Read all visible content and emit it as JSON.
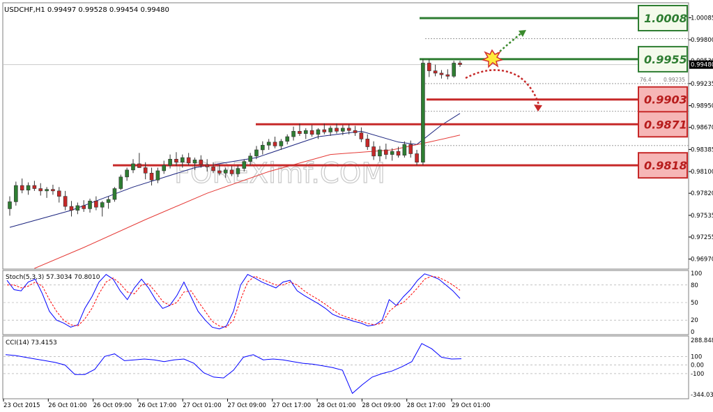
{
  "chart_data": [
    {
      "type": "candlestick",
      "symbol_header": "USDCHF,H1  0.99497 0.99528 0.99454 0.99480",
      "current_price": "0.99480",
      "ylim": [
        0.9685,
        1.0026
      ],
      "y_tick_labels": [
        "1.00085",
        "0.99800",
        "0.99530",
        "0.99235",
        "0.98950",
        "0.98670",
        "0.98385",
        "0.98100",
        "0.97820",
        "0.97535",
        "0.97255",
        "0.96970"
      ],
      "y_tick_values": [
        1.00085,
        0.998,
        0.9953,
        0.99235,
        0.9895,
        0.9867,
        0.98385,
        0.981,
        0.9782,
        0.97535,
        0.97255,
        0.9697
      ],
      "x_tick_labels": [
        "23 Oct 2015",
        "26 Oct 01:00",
        "26 Oct 09:00",
        "26 Oct 17:00",
        "27 Oct 01:00",
        "27 Oct 09:00",
        "27 Oct 17:00",
        "28 Oct 01:00",
        "28 Oct 09:00",
        "28 Oct 17:00",
        "29 Oct 01:00"
      ],
      "candles": [
        [
          0.9762,
          0.9778,
          0.9753,
          0.9771
        ],
        [
          0.9771,
          0.9797,
          0.9766,
          0.9792
        ],
        [
          0.9792,
          0.9801,
          0.9782,
          0.9786
        ],
        [
          0.9786,
          0.9796,
          0.978,
          0.9792
        ],
        [
          0.9792,
          0.9798,
          0.9785,
          0.9788
        ],
        [
          0.9788,
          0.9795,
          0.9779,
          0.9785
        ],
        [
          0.9785,
          0.979,
          0.9776,
          0.9787
        ],
        [
          0.9787,
          0.9793,
          0.978,
          0.9785
        ],
        [
          0.9785,
          0.979,
          0.977,
          0.9778
        ],
        [
          0.9778,
          0.9785,
          0.976,
          0.9765
        ],
        [
          0.9765,
          0.9772,
          0.9752,
          0.976
        ],
        [
          0.976,
          0.977,
          0.9755,
          0.9766
        ],
        [
          0.9766,
          0.9773,
          0.9758,
          0.9762
        ],
        [
          0.9762,
          0.9775,
          0.9757,
          0.9772
        ],
        [
          0.9772,
          0.9778,
          0.976,
          0.9764
        ],
        [
          0.9764,
          0.9772,
          0.9752,
          0.977
        ],
        [
          0.977,
          0.9778,
          0.9762,
          0.9774
        ],
        [
          0.9774,
          0.979,
          0.9771,
          0.9788
        ],
        [
          0.9788,
          0.9806,
          0.9786,
          0.9803
        ],
        [
          0.9803,
          0.9815,
          0.9798,
          0.9812
        ],
        [
          0.9812,
          0.9826,
          0.9808,
          0.982
        ],
        [
          0.982,
          0.9834,
          0.9815,
          0.9815
        ],
        [
          0.9815,
          0.9822,
          0.98,
          0.9808
        ],
        [
          0.9808,
          0.9815,
          0.9792,
          0.9799
        ],
        [
          0.9799,
          0.9815,
          0.9795,
          0.9811
        ],
        [
          0.9811,
          0.9824,
          0.9807,
          0.9818
        ],
        [
          0.9818,
          0.9832,
          0.9814,
          0.9826
        ],
        [
          0.9826,
          0.9835,
          0.9817,
          0.9822
        ],
        [
          0.9822,
          0.9832,
          0.9815,
          0.9828
        ],
        [
          0.9828,
          0.9834,
          0.9818,
          0.9821
        ],
        [
          0.9821,
          0.9828,
          0.9812,
          0.9825
        ],
        [
          0.9825,
          0.9831,
          0.9815,
          0.9819
        ],
        [
          0.9819,
          0.9826,
          0.981,
          0.9816
        ],
        [
          0.9816,
          0.9822,
          0.9808,
          0.9811
        ],
        [
          0.9811,
          0.9819,
          0.9805,
          0.9808
        ],
        [
          0.9808,
          0.9815,
          0.9802,
          0.9812
        ],
        [
          0.9812,
          0.9817,
          0.9804,
          0.9807
        ],
        [
          0.9807,
          0.9818,
          0.9803,
          0.9814
        ],
        [
          0.9814,
          0.9826,
          0.981,
          0.9823
        ],
        [
          0.9823,
          0.9834,
          0.9818,
          0.983
        ],
        [
          0.983,
          0.9843,
          0.9826,
          0.9838
        ],
        [
          0.9838,
          0.9849,
          0.9832,
          0.9844
        ],
        [
          0.9844,
          0.9852,
          0.9838,
          0.9848
        ],
        [
          0.9848,
          0.9855,
          0.984,
          0.9843
        ],
        [
          0.9843,
          0.9852,
          0.9838,
          0.9849
        ],
        [
          0.9849,
          0.9858,
          0.9845,
          0.9855
        ],
        [
          0.9855,
          0.9868,
          0.985,
          0.9862
        ],
        [
          0.9862,
          0.9872,
          0.9856,
          0.9859
        ],
        [
          0.9859,
          0.9866,
          0.9852,
          0.9863
        ],
        [
          0.9863,
          0.987,
          0.9855,
          0.9858
        ],
        [
          0.9858,
          0.9866,
          0.9852,
          0.9864
        ],
        [
          0.9864,
          0.9872,
          0.9858,
          0.9861
        ],
        [
          0.9861,
          0.9869,
          0.9856,
          0.9866
        ],
        [
          0.9866,
          0.9872,
          0.9859,
          0.9862
        ],
        [
          0.9862,
          0.987,
          0.9857,
          0.9866
        ],
        [
          0.9866,
          0.9871,
          0.9858,
          0.9863
        ],
        [
          0.9863,
          0.9869,
          0.9856,
          0.986
        ],
        [
          0.986,
          0.9867,
          0.9848,
          0.9852
        ],
        [
          0.9852,
          0.9858,
          0.9838,
          0.9842
        ],
        [
          0.9842,
          0.9849,
          0.9825,
          0.983
        ],
        [
          0.983,
          0.9843,
          0.9823,
          0.9838
        ],
        [
          0.9838,
          0.9846,
          0.9826,
          0.9832
        ],
        [
          0.9832,
          0.984,
          0.9824,
          0.9836
        ],
        [
          0.9836,
          0.9842,
          0.9828,
          0.9831
        ],
        [
          0.9831,
          0.9849,
          0.9828,
          0.9845
        ],
        [
          0.9845,
          0.985,
          0.9828,
          0.9833
        ],
        [
          0.9833,
          0.9838,
          0.9818,
          0.9822
        ],
        [
          0.9822,
          0.9955,
          0.9818,
          0.995
        ],
        [
          0.995,
          0.9955,
          0.9932,
          0.994
        ],
        [
          0.994,
          0.9948,
          0.9933,
          0.9937
        ],
        [
          0.9937,
          0.9941,
          0.993,
          0.9935
        ],
        [
          0.9935,
          0.9942,
          0.9929,
          0.9933
        ],
        [
          0.9933,
          0.9953,
          0.9931,
          0.995
        ],
        [
          0.995,
          0.9953,
          0.9945,
          0.9948
        ]
      ],
      "ma_blue": [
        [
          0,
          0.9738
        ],
        [
          10,
          0.976
        ],
        [
          20,
          0.979
        ],
        [
          30,
          0.9815
        ],
        [
          40,
          0.9828
        ],
        [
          50,
          0.9855
        ],
        [
          57,
          0.9862
        ],
        [
          63,
          0.9848
        ],
        [
          66,
          0.9845
        ],
        [
          70,
          0.987
        ],
        [
          73,
          0.9885
        ]
      ],
      "ma_red": [
        [
          4,
          0.9685
        ],
        [
          12,
          0.9712
        ],
        [
          22,
          0.9748
        ],
        [
          32,
          0.9782
        ],
        [
          42,
          0.981
        ],
        [
          52,
          0.9832
        ],
        [
          62,
          0.9838
        ],
        [
          68,
          0.9848
        ],
        [
          73,
          0.9857
        ]
      ],
      "fib_ratio_label": "76.4",
      "fib_price_label": "0.99235",
      "levels": [
        {
          "label": "1.0008",
          "value": 1.0008,
          "color": "#2e7d32",
          "kind": "resistance"
        },
        {
          "label": "0.9955",
          "value": 0.9955,
          "color": "#2e7d32",
          "kind": "resistance"
        },
        {
          "label": "0.9903",
          "value": 0.9903,
          "color": "#c62828",
          "kind": "support"
        },
        {
          "label": "0.9871",
          "value": 0.9871,
          "color": "#c62828",
          "kind": "support"
        },
        {
          "label": "0.9818",
          "value": 0.9818,
          "color": "#c62828",
          "kind": "support"
        }
      ],
      "watermark": "FOREXimf.COM"
    },
    {
      "type": "line",
      "title": "Stoch(5,3,3) 57.3034 70.8010",
      "ylim": [
        0,
        100
      ],
      "y_tick_labels": [
        "100",
        "80",
        "50",
        "20",
        "0"
      ],
      "y_tick_values": [
        100,
        80,
        50,
        20,
        0
      ],
      "series": [
        {
          "color": "#0000ff",
          "values": [
            88,
            72,
            70,
            85,
            90,
            65,
            35,
            20,
            15,
            8,
            12,
            40,
            60,
            85,
            98,
            90,
            70,
            55,
            75,
            90,
            75,
            55,
            40,
            45,
            62,
            85,
            60,
            35,
            20,
            8,
            5,
            10,
            35,
            80,
            98,
            92,
            85,
            80,
            75,
            85,
            88,
            70,
            62,
            55,
            48,
            40,
            30,
            25,
            22,
            18,
            15,
            10,
            12,
            20,
            55,
            45,
            60,
            72,
            88,
            99,
            95,
            90,
            80,
            70,
            57
          ]
        },
        {
          "color": "#ff0000",
          "values": [
            80,
            80,
            75,
            78,
            85,
            78,
            55,
            35,
            20,
            12,
            10,
            22,
            40,
            65,
            85,
            92,
            82,
            68,
            65,
            80,
            82,
            68,
            52,
            45,
            50,
            68,
            70,
            52,
            35,
            18,
            10,
            8,
            20,
            55,
            85,
            95,
            90,
            85,
            80,
            80,
            85,
            80,
            70,
            62,
            55,
            47,
            38,
            30,
            25,
            22,
            18,
            14,
            12,
            15,
            35,
            45,
            50,
            62,
            75,
            90,
            95,
            93,
            87,
            80,
            71
          ]
        }
      ]
    },
    {
      "type": "line",
      "title": "CCI(14) 73.4153",
      "ylim": [
        -344.0368,
        288.8484
      ],
      "y_tick_labels": [
        "288.848",
        "100",
        "0.00",
        "-100",
        "-344.036"
      ],
      "y_tick_values": [
        288.848,
        100,
        0,
        -100,
        -344.036
      ],
      "series": [
        {
          "color": "#0000ff",
          "values": [
            120,
            110,
            90,
            70,
            50,
            30,
            0,
            -110,
            -110,
            -50,
            100,
            130,
            50,
            60,
            70,
            60,
            40,
            60,
            70,
            20,
            -90,
            -140,
            -150,
            -60,
            90,
            120,
            60,
            70,
            60,
            40,
            20,
            10,
            -10,
            -30,
            -60,
            -330,
            -230,
            -140,
            -100,
            -70,
            -20,
            40,
            250,
            190,
            90,
            70,
            73
          ]
        }
      ]
    }
  ],
  "x_axis": {
    "labels": [
      "23 Oct 2015",
      "26 Oct 01:00",
      "26 Oct 09:00",
      "26 Oct 17:00",
      "27 Oct 01:00",
      "27 Oct 09:00",
      "27 Oct 17:00",
      "28 Oct 01:00",
      "28 Oct 09:00",
      "28 Oct 17:00",
      "29 Oct 01:00"
    ]
  },
  "colors": {
    "bull_fill": "#2e7d32",
    "bear_fill": "#c62828",
    "resistance_box_bg": "#f4faeb",
    "resistance_border": "#2e7d32",
    "support_box_bg": "#f6b6b6",
    "support_border": "#c62828",
    "price_marker_bg": "#000000"
  }
}
